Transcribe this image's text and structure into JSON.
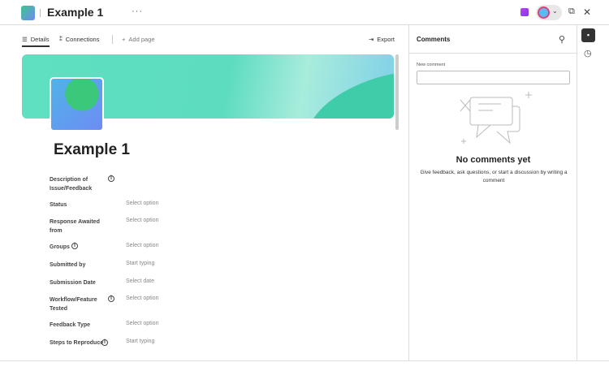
{
  "header": {
    "title": "Example 1",
    "more": "···"
  },
  "tabs": [
    {
      "label": "Details"
    },
    {
      "label": "Connections"
    },
    {
      "label": "Add page"
    }
  ],
  "export_label": "Export",
  "page": {
    "title": "Example 1"
  },
  "fields": [
    {
      "label": "Description of Issue/Feedback",
      "value": "",
      "info": true
    },
    {
      "label": "Status",
      "value": "Select option",
      "info": false
    },
    {
      "label": "Response Awaited from",
      "value": "Select option",
      "info": false
    },
    {
      "label": "Groups",
      "value": "Select option",
      "info": true
    },
    {
      "label": "Submitted by",
      "value": "Start typing",
      "info": false
    },
    {
      "label": "Submission Date",
      "value": "Select date",
      "info": false
    },
    {
      "label": "Workflow/Feature Tested",
      "value": "Select option",
      "info": true
    },
    {
      "label": "Feedback Type",
      "value": "Select option",
      "info": false
    },
    {
      "label": "Steps to Reproduce",
      "value": "Start typing",
      "info": true
    }
  ],
  "comments": {
    "title": "Comments",
    "new_label": "New comment",
    "empty_title": "No comments yet",
    "empty_text": "Give feedback, ask questions, or start a discussion by writing a comment"
  }
}
